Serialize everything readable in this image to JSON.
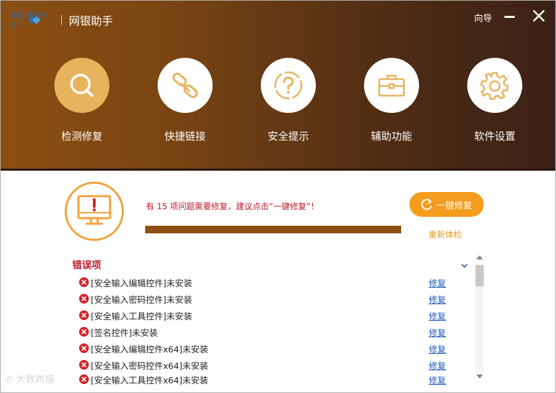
{
  "window": {
    "bank_logo_text": "建设 建设银行",
    "app_title": "网银助手",
    "guide_label": "向导"
  },
  "nav": [
    {
      "label": "检测修复",
      "icon": "search-icon",
      "active": true
    },
    {
      "label": "快捷链接",
      "icon": "link-icon",
      "active": false
    },
    {
      "label": "安全提示",
      "icon": "question-icon",
      "active": false
    },
    {
      "label": "辅助功能",
      "icon": "toolbox-icon",
      "active": false
    },
    {
      "label": "软件设置",
      "icon": "gear-icon",
      "active": false
    }
  ],
  "status": {
    "message": "有 15 项问题需要修复，建议点击“一键修复”！",
    "fix_all_label": "一键修复",
    "recheck_label": "重新体检",
    "progress": 1.0,
    "progress_color": "#8e4f13"
  },
  "errors": {
    "title": "错误项",
    "items": [
      {
        "text": "[安全输入编辑控件]未安装",
        "action": "修复"
      },
      {
        "text": "[安全输入密码控件]未安装",
        "action": "修复"
      },
      {
        "text": "[安全输入工具控件]未安装",
        "action": "修复"
      },
      {
        "text": "[签名控件]未安装",
        "action": "修复"
      },
      {
        "text": "[安全输入编辑控件x64]未安装",
        "action": "修复"
      },
      {
        "text": "[安全输入密码控件x64]未安装",
        "action": "修复"
      },
      {
        "text": "[安全输入工具控件x64]未安装",
        "action": "修复"
      }
    ]
  },
  "watermark": "大数跨境",
  "colors": {
    "accent": "#f39c1e",
    "error": "#c0192b",
    "link": "#1a56b8",
    "active_nav": "#e8b35d"
  }
}
